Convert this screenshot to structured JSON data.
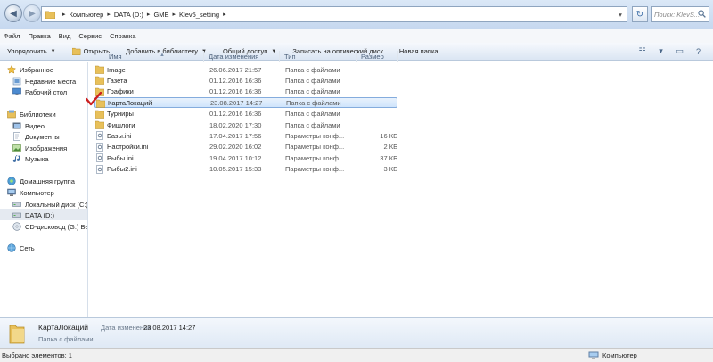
{
  "address": {
    "crumbs": [
      "Компьютер",
      "DATA (D:)",
      "GME",
      "Klev5_setting"
    ],
    "search_placeholder": "Поиск: KlevS..."
  },
  "menu": [
    "Файл",
    "Правка",
    "Вид",
    "Сервис",
    "Справка"
  ],
  "commands": {
    "organize": "Упорядочить",
    "open": "Открыть",
    "add_library": "Добавить в библиотеку",
    "share": "Общий доступ",
    "burn": "Записать на оптический диск",
    "new_folder": "Новая папка"
  },
  "sidebar": {
    "favorites": "Избранное",
    "recent": "Недавние места",
    "desktop": "Рабочий стол",
    "libraries": "Библиотеки",
    "video": "Видео",
    "documents": "Документы",
    "images": "Изображения",
    "music": "Музыка",
    "homegroup": "Домашняя группа",
    "computer": "Компьютер",
    "local_c": "Локальный диск (C:)",
    "data_d": "DATA (D:)",
    "cd_g": "CD-дисковод (G:) Bee",
    "network": "Сеть"
  },
  "columns": {
    "name": "Имя",
    "date": "Дата изменения",
    "type": "Тип",
    "size": "Размер"
  },
  "files": [
    {
      "name": "Image",
      "date": "26.06.2017 21:57",
      "type": "Папка с файлами",
      "size": "",
      "kind": "folder"
    },
    {
      "name": "Газета",
      "date": "01.12.2016 16:36",
      "type": "Папка с файлами",
      "size": "",
      "kind": "folder"
    },
    {
      "name": "Графики",
      "date": "01.12.2016 16:36",
      "type": "Папка с файлами",
      "size": "",
      "kind": "folder"
    },
    {
      "name": "КартаЛокаций",
      "date": "23.08.2017 14:27",
      "type": "Папка с файлами",
      "size": "",
      "kind": "folder"
    },
    {
      "name": "Турниры",
      "date": "01.12.2016 16:36",
      "type": "Папка с файлами",
      "size": "",
      "kind": "folder"
    },
    {
      "name": "Фишлоги",
      "date": "18.02.2020 17:30",
      "type": "Папка с файлами",
      "size": "",
      "kind": "folder"
    },
    {
      "name": "Базы.ini",
      "date": "17.04.2017 17:56",
      "type": "Параметры конф...",
      "size": "16 КБ",
      "kind": "ini"
    },
    {
      "name": "Настройки.ini",
      "date": "29.02.2020 16:02",
      "type": "Параметры конф...",
      "size": "2 КБ",
      "kind": "ini"
    },
    {
      "name": "Рыбы.ini",
      "date": "19.04.2017 10:12",
      "type": "Параметры конф...",
      "size": "37 КБ",
      "kind": "ini"
    },
    {
      "name": "Рыбы2.ini",
      "date": "10.05.2017 15:33",
      "type": "Параметры конф...",
      "size": "3 КБ",
      "kind": "ini"
    }
  ],
  "details": {
    "name": "КартаЛокаций",
    "modified_label": "Дата изменения:",
    "modified": "23.08.2017 14:27",
    "type": "Папка с файлами"
  },
  "status": {
    "selected": "Выбрано элементов: 1",
    "location": "Компьютер"
  },
  "colors": {
    "folder": "#e8c05a",
    "selection": "#cfe4fb",
    "check": "#cc1f1f"
  }
}
